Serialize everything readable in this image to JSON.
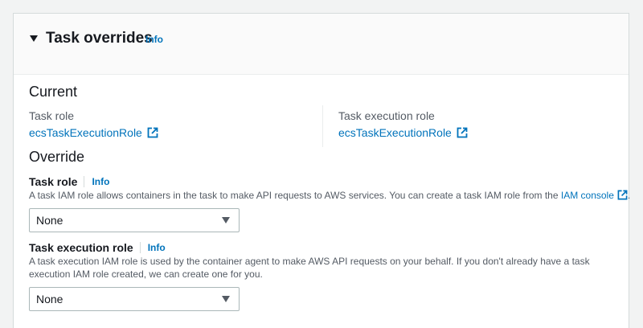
{
  "header": {
    "title": "Task overrides",
    "info": "Info"
  },
  "current": {
    "heading": "Current",
    "task_role_label": "Task role",
    "task_role_value": "ecsTaskExecutionRole",
    "exec_role_label": "Task execution role",
    "exec_role_value": "ecsTaskExecutionRole"
  },
  "override": {
    "heading": "Override",
    "task_role": {
      "label": "Task role",
      "info": "Info",
      "description_prefix": "A task IAM role allows containers in the task to make API requests to AWS services. You can create a task IAM role from the",
      "description_link": "IAM console",
      "description_suffix": ".",
      "selected": "None"
    },
    "exec_role": {
      "label": "Task execution role",
      "info": "Info",
      "description": "A task execution IAM role is used by the container agent to make AWS API requests on your behalf. If you don't already have a task execution IAM role created, we can create one for you.",
      "selected": "None"
    }
  },
  "colors": {
    "link": "#0073bb",
    "text": "#16191f",
    "muted": "#545b64",
    "border": "#aab7b8"
  }
}
